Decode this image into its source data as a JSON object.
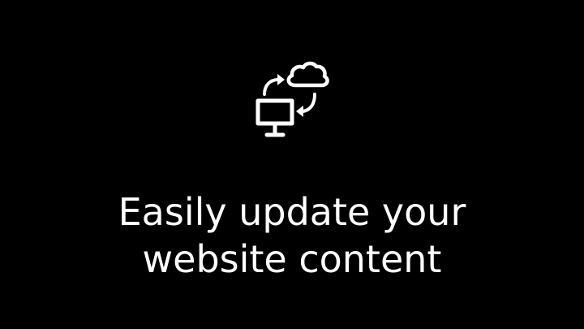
{
  "slide": {
    "icon": "computer-cloud-sync-icon",
    "headline_line1": "Easily update your",
    "headline_line2": "website content"
  },
  "colors": {
    "background": "#000000",
    "foreground": "#ffffff"
  }
}
